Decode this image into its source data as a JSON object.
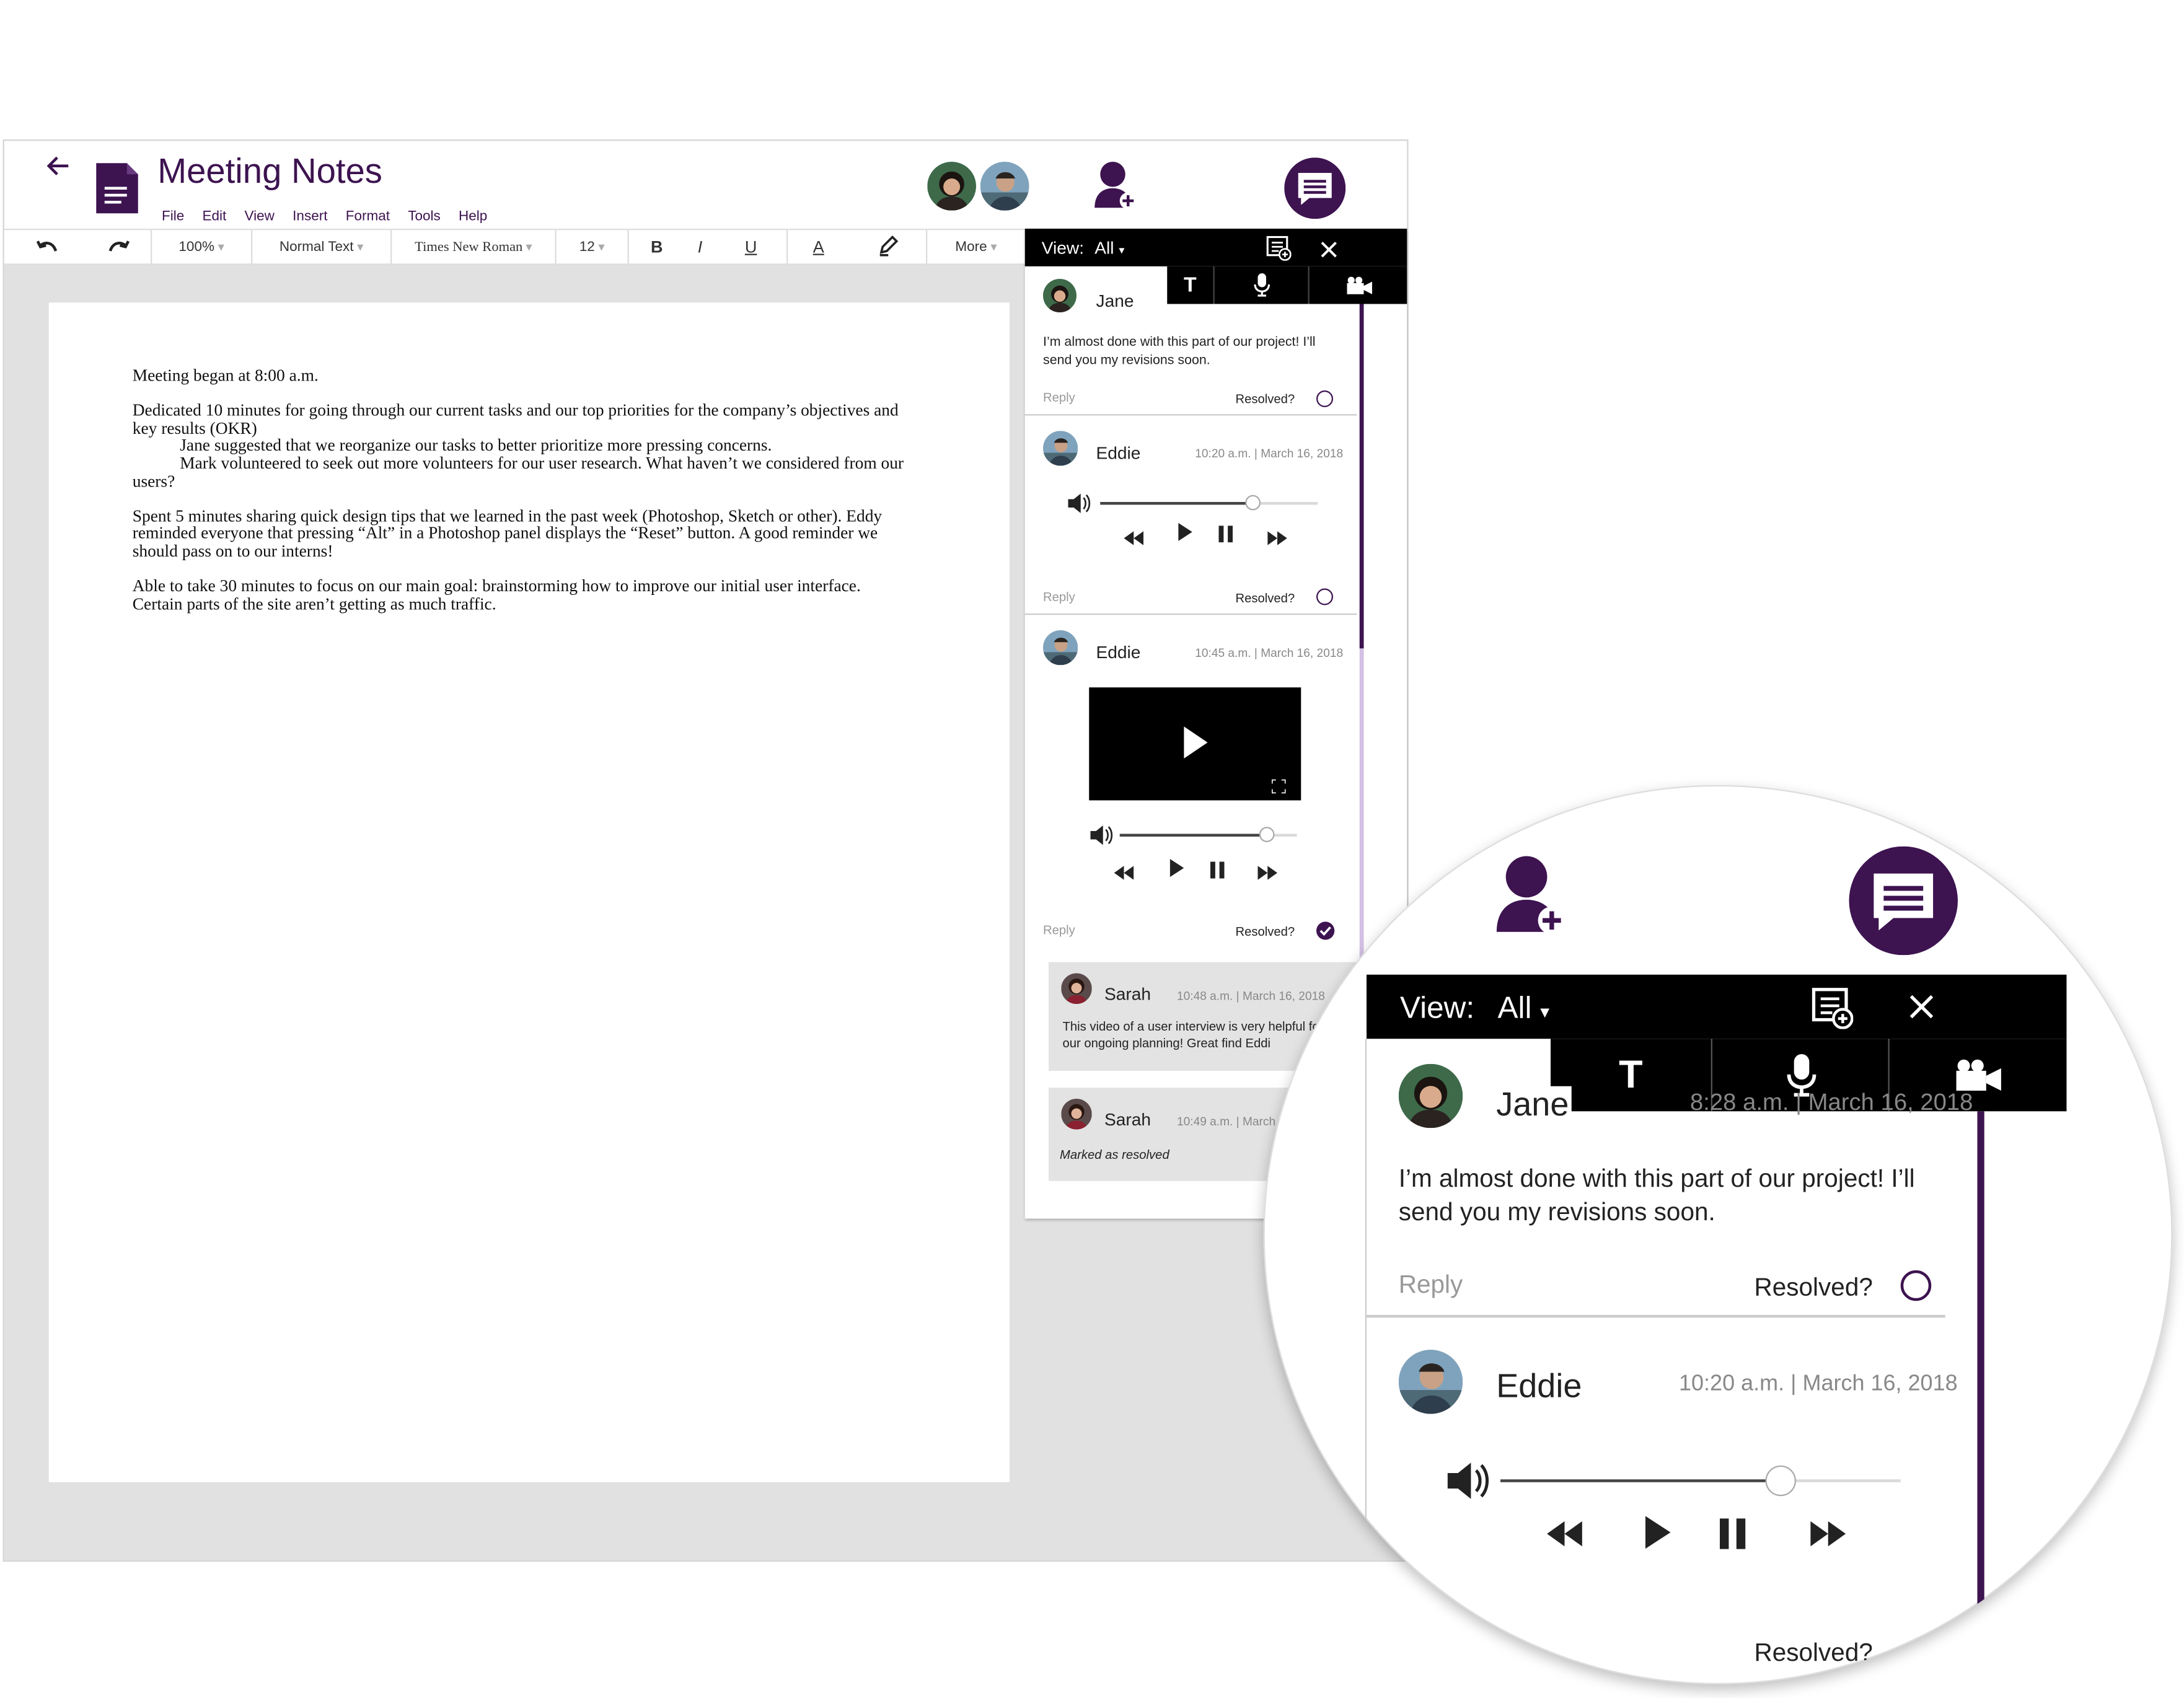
{
  "doc": {
    "title": "Meeting Notes",
    "menu": [
      "File",
      "Edit",
      "View",
      "Insert",
      "Format",
      "Tools",
      "Help"
    ],
    "toolbar": {
      "zoom": "100%",
      "style": "Normal Text",
      "font": "Times New Roman",
      "size": "12",
      "bold": "B",
      "italic": "I",
      "underline": "U",
      "textcolor": "A",
      "more": "More"
    },
    "body": {
      "p1": "Meeting began at 8:00 a.m.",
      "p2a": "Dedicated 10 minutes for going through our current tasks and our top priorities for the company’s objectives and key results (OKR)",
      "p2b": "Jane suggested that we reorganize our tasks to better prioritize more pressing concerns.",
      "p2c": "Mark volunteered to seek out more volunteers for our user research. What haven’t we considered from our users?",
      "p3": "Spent 5 minutes sharing quick design tips that we learned in the past week (Photoshop, Sketch or other). Eddy reminded everyone that pressing “Alt” in a Photoshop panel displays the “Reset” button. A good reminder we should pass on to our interns!",
      "p4": "Able to take 30 minutes to focus on our main goal: brainstorming how to improve our initial user interface. Certain parts of the site aren’t getting as much traffic."
    }
  },
  "panel": {
    "view_label": "View:",
    "view_value": "All",
    "tools": {
      "text": "T"
    },
    "c1": {
      "name": "Jane",
      "text": "I’m almost done with this part of our project! I’ll send you my revisions soon.",
      "reply": "Reply",
      "resolved": "Resolved?"
    },
    "c2": {
      "name": "Eddie",
      "time": "10:20 a.m. | March 16, 2018",
      "reply": "Reply",
      "resolved": "Resolved?",
      "progress": 0.7
    },
    "c3": {
      "name": "Eddie",
      "time": "10:45 a.m. | March 16, 2018",
      "reply": "Reply",
      "resolved": "Resolved?",
      "progress": 0.83
    },
    "c4": {
      "name": "Sarah",
      "time": "10:48 a.m. | March 16, 2018",
      "text": "This video of a user interview is very helpful for our ongoing planning! Great find Eddi"
    },
    "c5": {
      "name": "Sarah",
      "time": "10:49 a.m. | March",
      "text": "Marked as resolved"
    }
  },
  "zoom": {
    "view_label": "View:",
    "view_value": "All",
    "tool_text": "T",
    "jane": "Jane",
    "jane_time": "8:28 a.m. | March 16, 2018",
    "jane_text": "I’m almost done with this part of our project! I’ll send you my revisions soon.",
    "reply": "Reply",
    "resolved": "Resolved?",
    "eddie": "Eddie",
    "eddie_time": "10:20 a.m. | March 16, 2018",
    "resolved2": "Resolved?"
  },
  "colors": {
    "brand": "#3d1350",
    "toolbar_dark": "#000000",
    "canvas": "#e1e1e1"
  }
}
